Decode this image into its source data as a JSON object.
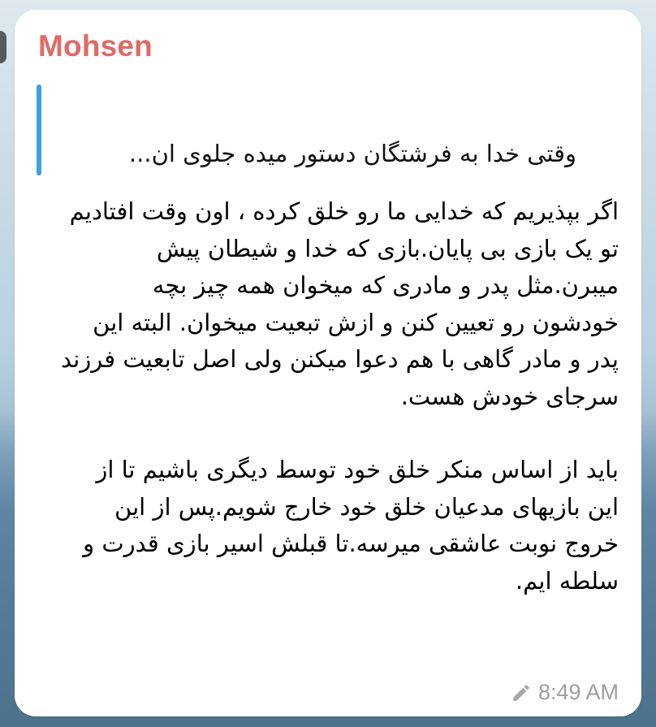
{
  "message": {
    "sender": "Mohsen",
    "reply_preview": "وقتی خدا به فرشتگان دستور میده جلوی ان...",
    "paragraphs": [
      "اگر بپذیریم که خدایی ما رو خلق کرده ، اون وقت افتادیم تو یک بازی بی پایان.بازی که خدا و شیطان پیش میبرن.مثل پدر و مادری که میخوان همه چیز بچه خودشون رو تعیین کنن و ازش تبعیت  میخوان. البته این پدر و مادر گاهی با هم دعوا میکنن ولی اصل تابعیت فرزند سرجای خودش هست.",
      "باید از اساس منکر خلق خود توسط دیگری باشیم تا از این بازیهای مدعیان خلق خود خارج شویم.پس از این خروج نوبت عاشقی میرسه.تا قبلش اسیر بازی قدرت و سلطه ایم."
    ],
    "time": "8:49 AM",
    "edited_icon": "pencil-icon"
  },
  "colors": {
    "sender": "#e06a65",
    "reply_bar": "#3ba2df",
    "meta": "#9a9ea3"
  }
}
